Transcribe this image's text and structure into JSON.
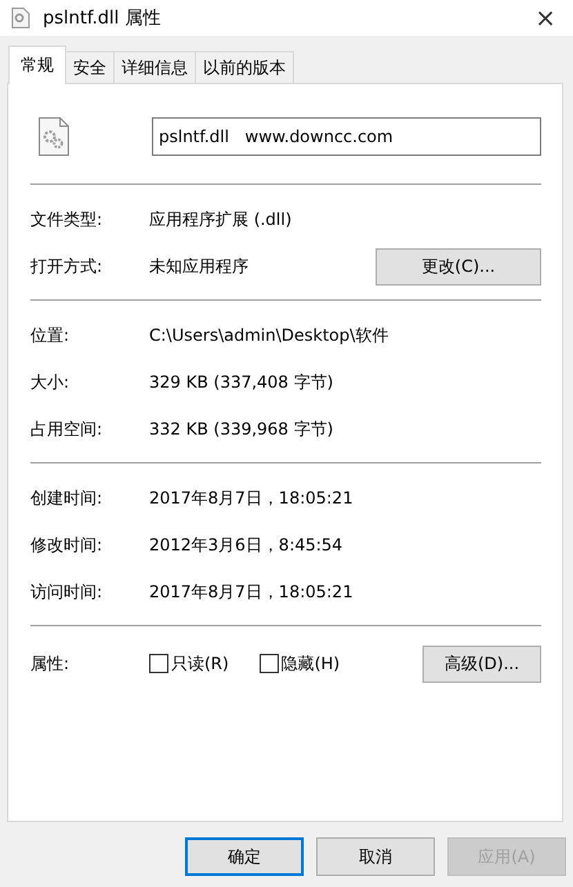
{
  "window": {
    "title": "pslntf.dll 属性",
    "close": "×"
  },
  "tabs": [
    {
      "label": "常规",
      "selected": true
    },
    {
      "label": "安全",
      "selected": false
    },
    {
      "label": "详细信息",
      "selected": false
    },
    {
      "label": "以前的版本",
      "selected": false
    }
  ],
  "file_name": {
    "value": "pslntf.dll   www.downcc.com"
  },
  "sections": [
    {
      "rows": [
        {
          "label": "文件类型:",
          "value": "应用程序扩展 (.dll)"
        },
        {
          "label": "打开方式:",
          "value": "未知应用程序",
          "button": "更改(C)..."
        }
      ]
    },
    {
      "rows": [
        {
          "label": "位置:",
          "value": "C:\\Users\\admin\\Desktop\\软件"
        },
        {
          "label": "大小:",
          "value": "329 KB (337,408 字节)"
        },
        {
          "label": "占用空间:",
          "value": "332 KB (339,968 字节)"
        }
      ]
    },
    {
      "rows": [
        {
          "label": "创建时间:",
          "value": "2017年8月7日，18:05:21"
        },
        {
          "label": "修改时间:",
          "value": "2012年3月6日，8:45:54"
        },
        {
          "label": "访问时间:",
          "value": "2017年8月7日，18:05:21"
        }
      ]
    }
  ],
  "attributes": {
    "label": "属性:",
    "checkboxes": [
      {
        "label": "只读(R)",
        "checked": false
      },
      {
        "label": "隐藏(H)",
        "checked": false
      }
    ],
    "button": "高级(D)..."
  },
  "buttons": [
    {
      "label": "确定",
      "default": true,
      "disabled": false
    },
    {
      "label": "取消",
      "default": false,
      "disabled": false
    },
    {
      "label": "应用(A)",
      "default": false,
      "disabled": true
    }
  ]
}
